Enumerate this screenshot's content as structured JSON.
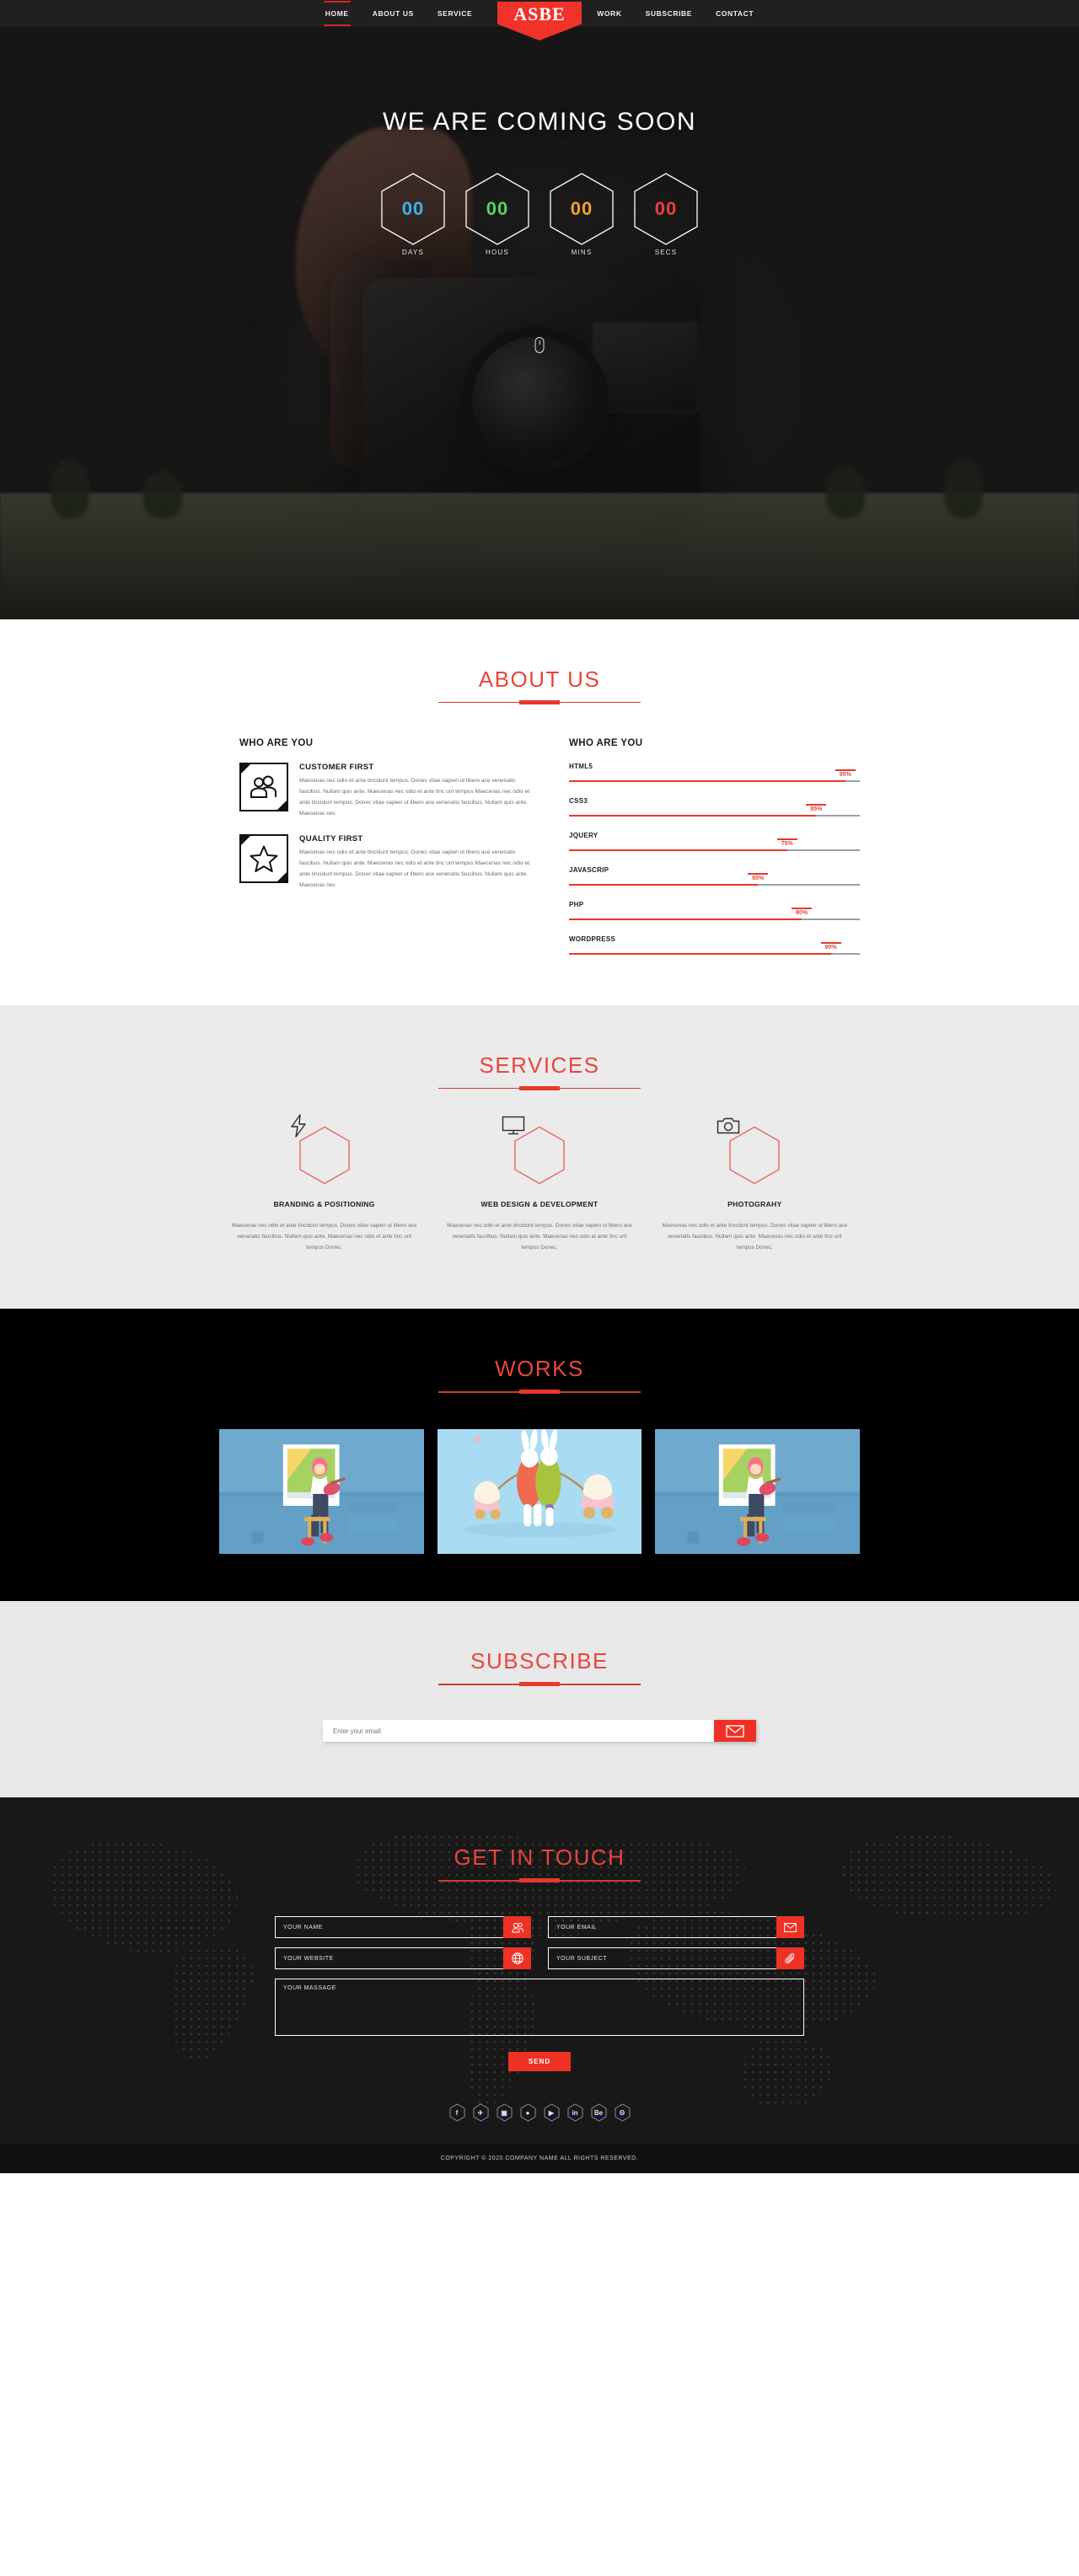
{
  "nav": {
    "logo": "ASBE",
    "left_items": [
      {
        "label": "HOME",
        "active": true
      },
      {
        "label": "ABOUT US",
        "active": false
      },
      {
        "label": "SERVICE",
        "active": false
      }
    ],
    "right_items": [
      {
        "label": "WORK",
        "active": false
      },
      {
        "label": "SUBSCRIBE",
        "active": false
      },
      {
        "label": "CONTACT",
        "active": false
      }
    ]
  },
  "hero": {
    "title": "WE ARE COMING SOON",
    "countdown": [
      {
        "value": "00",
        "label": "DAYS",
        "color": "#39b6e8"
      },
      {
        "value": "00",
        "label": "HOUS",
        "color": "#4bd964"
      },
      {
        "value": "00",
        "label": "MINS",
        "color": "#f0a22e"
      },
      {
        "value": "00",
        "label": "SECS",
        "color": "#ef3d3d"
      }
    ],
    "scroll_hint_icon": "mouse-scroll-icon"
  },
  "about": {
    "title": "ABOUT US",
    "left_heading": "WHO ARE YOU",
    "right_heading": "WHO ARE YOU",
    "features": [
      {
        "icon": "users-icon",
        "title": "CUSTOMER FIRST",
        "text": "Maecenas nec odio et ante tincidunt tempus. Donec vitae sapien ut libero ace venenatis faucibus. Nullam quis ante. Maecenas nec odio et ante tinc unt tempus Maecenas nec odio et ante tincidunt tempus. Donec vitae sapien ut libero ace venenatis faucibus. Nullam quis ante. Maecenas nec"
      },
      {
        "icon": "star-icon",
        "title": "QUALITY FIRST",
        "text": "Maecenas nec odio et ante tincidunt tempus. Donec vitae sapien ut libero ace venenatis faucibus. Nullam quis ante. Maecenas nec odio et ante tinc unt tempus Maecenas nec odio et ante tincidunt tempus. Donec vitae sapien ut libero ace venenatis faucibus. Nullam quis ante. Maecenas nec"
      }
    ],
    "skills": [
      {
        "name": "HTML5",
        "percent": 95,
        "label": "95%"
      },
      {
        "name": "CSS3",
        "percent": 85,
        "label": "85%"
      },
      {
        "name": "JQUERY",
        "percent": 75,
        "label": "75%"
      },
      {
        "name": "JAVASCRIP",
        "percent": 65,
        "label": "65%"
      },
      {
        "name": "PHP",
        "percent": 80,
        "label": "80%"
      },
      {
        "name": "WORDPRESS",
        "percent": 90,
        "label": "90%"
      }
    ]
  },
  "services": {
    "title": "SERVICES",
    "items": [
      {
        "icon": "bolt-icon",
        "title": "BRANDING & POSITIONING",
        "text": "Maecenas nec odio et ante tincidunt tempus. Donec vitae sapien ut libero ace venenatis faucibus. Nullam quis ante. Maecenas nec odio et ante tinc unt tempus Donec."
      },
      {
        "icon": "monitor-icon",
        "title": "WEB DESIGN & DEVELOPMENT",
        "text": "Maecenas nec odio et ante tincidunt tempus. Donec vitae sapien ut libero ace venenatis faucibus. Nullam quis ante. Maecenas nec odio et ante tinc unt tempus Donec."
      },
      {
        "icon": "camera-icon",
        "title": "PHOTOGRAHY",
        "text": "Maecenas nec odio et ante tincidunt tempus. Donec vitae sapien ut libero ace venenatis faucibus. Nullam quis ante. Maecenas nec odio et ante tinc unt tempus Donec."
      }
    ]
  },
  "works": {
    "title": "WORKS",
    "items": [
      {
        "name": "work-thumb-guitar-girl"
      },
      {
        "name": "work-thumb-easter-bunnies"
      },
      {
        "name": "work-thumb-guitar-girl-2"
      }
    ]
  },
  "subscribe": {
    "title": "SUBSCRIBE",
    "placeholder": "Enter your email",
    "value": "",
    "button_icon": "envelope-icon"
  },
  "contact": {
    "title": "GET IN TOUCH",
    "fields": [
      {
        "placeholder": "YOUR NAME",
        "value": "",
        "icon": "users-icon"
      },
      {
        "placeholder": "YOUR EMAIL",
        "value": "",
        "icon": "envelope-icon"
      },
      {
        "placeholder": "YOUR WEBSITE",
        "value": "",
        "icon": "globe-icon"
      },
      {
        "placeholder": "YOUR SUBJECT",
        "value": "",
        "icon": "paperclip-icon"
      }
    ],
    "message_placeholder": "YOUR MASSAGE",
    "message_value": "",
    "send_label": "SEND",
    "socials": [
      {
        "name": "facebook",
        "glyph": "f"
      },
      {
        "name": "twitter",
        "glyph": "✈"
      },
      {
        "name": "instagram",
        "glyph": "▣"
      },
      {
        "name": "dribbble",
        "glyph": "●"
      },
      {
        "name": "youtube",
        "glyph": "▶"
      },
      {
        "name": "linkedin",
        "glyph": "in"
      },
      {
        "name": "behance",
        "glyph": "Be"
      },
      {
        "name": "pinterest",
        "glyph": "Θ"
      }
    ],
    "copyright": "COPYRIGHT © 2020.COMPANY NAME ALL RIGHTS RESERVED."
  },
  "theme": {
    "accent": "#ee3124",
    "accent_light": "#e8463c",
    "dark": "#191818",
    "nav_bg": "#211f1f",
    "grey_section": "#ebebeb"
  }
}
